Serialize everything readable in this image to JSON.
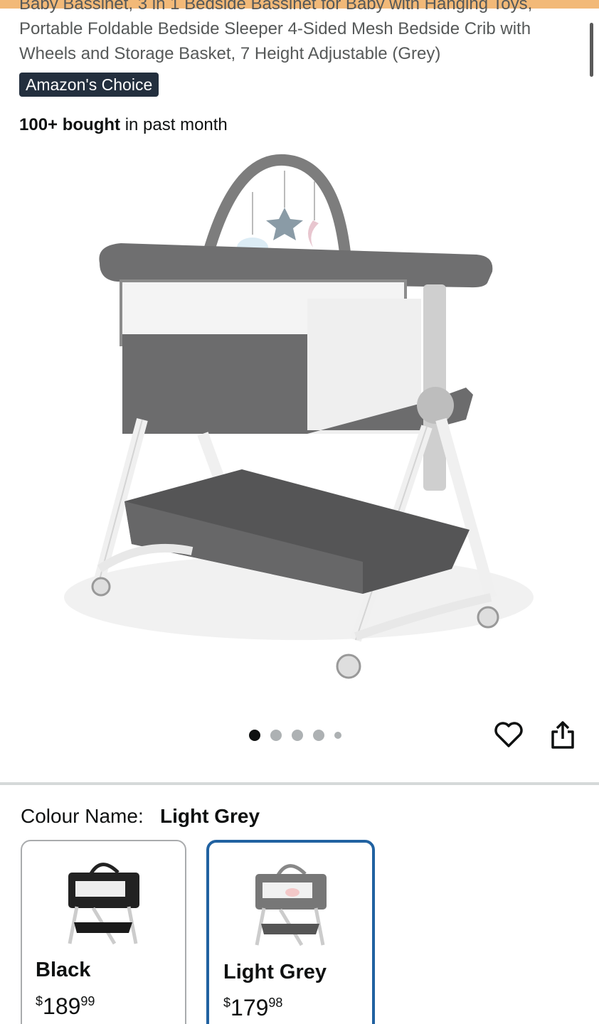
{
  "product": {
    "title": "Baby Bassinet, 3 in 1 Bedside Bassinet for Baby with Hanging Toys, Portable Foldable Bedside Sleeper 4-Sided Mesh Bedside Crib with Wheels and Storage Basket, 7 Height Adjustable (Grey)",
    "badge": "Amazon's Choice",
    "bought_bold": "100+ bought",
    "bought_rest": " in past month",
    "image_icon": "bassinet-product-image",
    "carousel_total": 5,
    "carousel_active": 1
  },
  "actions": {
    "wishlist_icon": "heart-icon",
    "share_icon": "share-icon"
  },
  "colour": {
    "label": "Colour Name:",
    "selected": "Light Grey",
    "options": [
      {
        "name": "Black",
        "currency": "$",
        "whole": "189",
        "cents": "99"
      },
      {
        "name": "Light Grey",
        "currency": "$",
        "whole": "179",
        "cents": "98"
      }
    ]
  },
  "colors": {
    "accent_strip": "#f2b978",
    "badge_bg": "#232f3e",
    "selected_border": "#2162a1"
  }
}
